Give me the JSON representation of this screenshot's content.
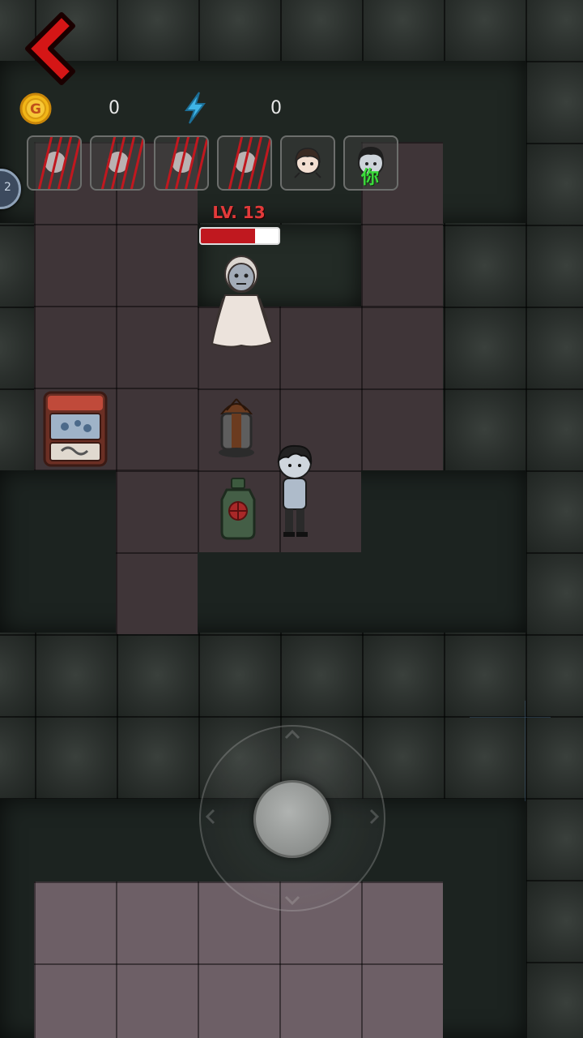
{
  "hud": {
    "coin_icon": "gold-coin-icon",
    "coin_icon_letter": "G",
    "coin_count": "0",
    "energy_icon": "lightning-icon",
    "energy_count": "0",
    "side_badge": "2",
    "back_icon": "red-chevron-left-icon"
  },
  "slots": [
    {
      "type": "clawed-portrait",
      "icon": "claw-marks-icon"
    },
    {
      "type": "clawed-portrait",
      "icon": "claw-marks-icon"
    },
    {
      "type": "clawed-portrait",
      "icon": "claw-marks-icon"
    },
    {
      "type": "clawed-portrait",
      "icon": "claw-marks-icon"
    },
    {
      "type": "portrait",
      "icon": "girl-face-icon"
    },
    {
      "type": "portrait",
      "icon": "player-face-icon",
      "label": "你"
    }
  ],
  "ghost": {
    "level_label": "LV. 13",
    "hp_fraction": 0.7
  },
  "colors": {
    "hp": "#c0181f",
    "level_text": "#e23a3a",
    "back_arrow": "#d51616",
    "energy": "#3fb4e6",
    "coin": "#f2b617",
    "tag_green": "#3cdc3c"
  }
}
